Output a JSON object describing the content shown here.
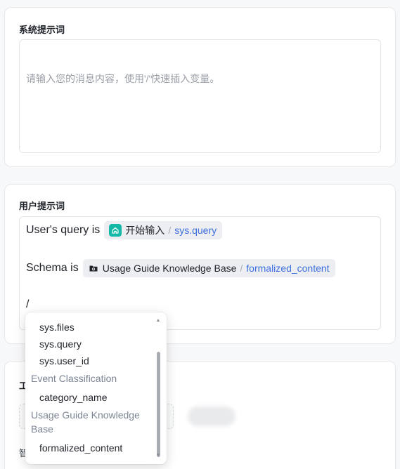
{
  "system_prompt": {
    "title": "系统提示词",
    "placeholder": "请输入您的消息内容，使用'/'快速插入变量。"
  },
  "user_prompt": {
    "title": "用户提示词",
    "line1": {
      "text": "User's query is",
      "chip": {
        "source": "开始输入",
        "separator": "/",
        "variable": "sys.query",
        "icon": "home-icon"
      }
    },
    "line2": {
      "text": "Schema is",
      "chip": {
        "source": "Usage Guide Knowledge Base",
        "separator": "/",
        "variable": "formalized_content",
        "icon": "knowledge-base-icon"
      }
    },
    "line3": {
      "text": "/"
    }
  },
  "third_card": {
    "partial_title": "工",
    "partial_label": "智"
  },
  "dropdown": {
    "items_top": [
      "sys.files",
      "sys.query",
      "sys.user_id"
    ],
    "group1": "Event Classification",
    "group1_items": [
      "category_name"
    ],
    "group2": "Usage Guide Knowledge Base",
    "group2_items": [
      "formalized_content"
    ]
  },
  "colors": {
    "accent_link": "#3d6fe0",
    "chip_icon_teal": "#14b8a6",
    "group_label": "#7b8594"
  }
}
